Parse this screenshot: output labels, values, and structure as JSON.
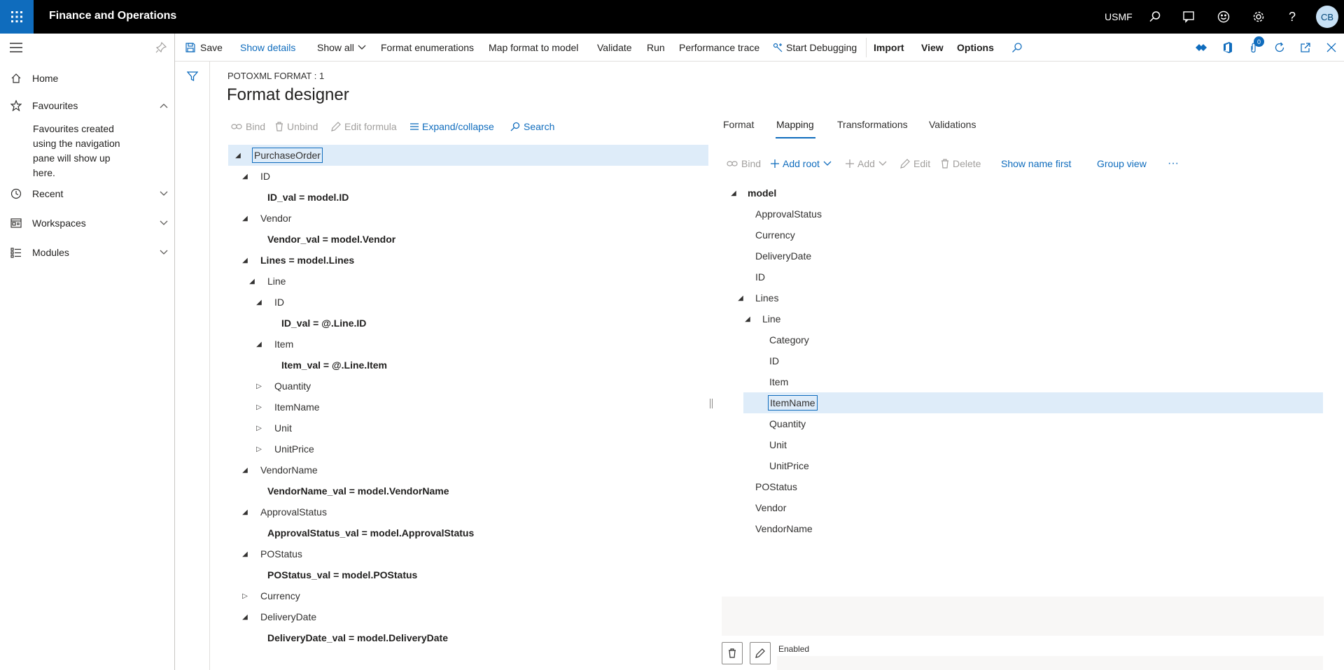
{
  "app": {
    "title": "Finance and Operations",
    "company": "USMF",
    "user_initials": "CB",
    "notification_count": "0",
    "accent": "#0f6cbd"
  },
  "nav": {
    "items": [
      {
        "label": "Home",
        "icon": "home-icon"
      },
      {
        "label": "Favourites",
        "icon": "star-icon"
      },
      {
        "label": "Recent",
        "icon": "clock-icon"
      },
      {
        "label": "Workspaces",
        "icon": "workspace-icon"
      },
      {
        "label": "Modules",
        "icon": "list-icon"
      }
    ],
    "favourites_hint": "Favourites created using the navigation pane will show up here."
  },
  "actionpane": {
    "save": "Save",
    "show_details": "Show details",
    "show_all": "Show all",
    "format_enumerations": "Format enumerations",
    "map_format_to_model": "Map format to model",
    "validate": "Validate",
    "run": "Run",
    "performance_trace": "Performance trace",
    "start_debugging": "Start Debugging",
    "import": "Import",
    "view": "View",
    "options": "Options"
  },
  "page": {
    "caption": "POTOXML FORMAT : 1",
    "title": "Format designer"
  },
  "format_toolbar": {
    "bind": "Bind",
    "unbind": "Unbind",
    "edit_formula": "Edit formula",
    "expand_collapse": "Expand/collapse",
    "search": "Search"
  },
  "format_tree": [
    {
      "label": "PurchaseOrder",
      "state": "expanded"
    },
    {
      "label": "ID",
      "state": "expanded"
    },
    {
      "label": "ID_val = model.ID",
      "state": "leaf"
    },
    {
      "label": "Vendor",
      "state": "expanded"
    },
    {
      "label": "Vendor_val = model.Vendor",
      "state": "leaf"
    },
    {
      "label": "Lines = model.Lines",
      "state": "expanded"
    },
    {
      "label": "Line",
      "state": "expanded"
    },
    {
      "label": "ID",
      "state": "expanded"
    },
    {
      "label": "ID_val = @.Line.ID",
      "state": "leaf"
    },
    {
      "label": "Item",
      "state": "expanded"
    },
    {
      "label": "Item_val = @.Line.Item",
      "state": "leaf"
    },
    {
      "label": "Quantity",
      "state": "collapsed"
    },
    {
      "label": "ItemName",
      "state": "collapsed"
    },
    {
      "label": "Unit",
      "state": "collapsed"
    },
    {
      "label": "UnitPrice",
      "state": "collapsed"
    },
    {
      "label": "VendorName",
      "state": "expanded"
    },
    {
      "label": "VendorName_val = model.VendorName",
      "state": "leaf"
    },
    {
      "label": "ApprovalStatus",
      "state": "expanded"
    },
    {
      "label": "ApprovalStatus_val = model.ApprovalStatus",
      "state": "leaf"
    },
    {
      "label": "POStatus",
      "state": "expanded"
    },
    {
      "label": "POStatus_val = model.POStatus",
      "state": "leaf"
    },
    {
      "label": "Currency",
      "state": "collapsed"
    },
    {
      "label": "DeliveryDate",
      "state": "expanded"
    },
    {
      "label": "DeliveryDate_val = model.DeliveryDate",
      "state": "leaf"
    }
  ],
  "tabs": [
    {
      "label": "Format"
    },
    {
      "label": "Mapping"
    },
    {
      "label": "Transformations"
    },
    {
      "label": "Validations"
    }
  ],
  "mapping_toolbar": {
    "bind": "Bind",
    "add_root": "Add root",
    "add": "Add",
    "edit": "Edit",
    "delete": "Delete",
    "show_name_first": "Show name first",
    "group_view": "Group view",
    "more": "···"
  },
  "mapping_tree": [
    {
      "label": "model",
      "state": "expanded"
    },
    {
      "label": "ApprovalStatus",
      "state": "leaf"
    },
    {
      "label": "Currency",
      "state": "leaf"
    },
    {
      "label": "DeliveryDate",
      "state": "leaf"
    },
    {
      "label": "ID",
      "state": "leaf"
    },
    {
      "label": "Lines",
      "state": "expanded"
    },
    {
      "label": "Line",
      "state": "expanded"
    },
    {
      "label": "Category",
      "state": "leaf"
    },
    {
      "label": "ID",
      "state": "leaf"
    },
    {
      "label": "Item",
      "state": "leaf"
    },
    {
      "label": "ItemName",
      "state": "leaf"
    },
    {
      "label": "Quantity",
      "state": "leaf"
    },
    {
      "label": "Unit",
      "state": "leaf"
    },
    {
      "label": "UnitPrice",
      "state": "leaf"
    },
    {
      "label": "POStatus",
      "state": "leaf"
    },
    {
      "label": "Vendor",
      "state": "leaf"
    },
    {
      "label": "VendorName",
      "state": "leaf"
    }
  ],
  "footer": {
    "enabled_label": "Enabled"
  }
}
